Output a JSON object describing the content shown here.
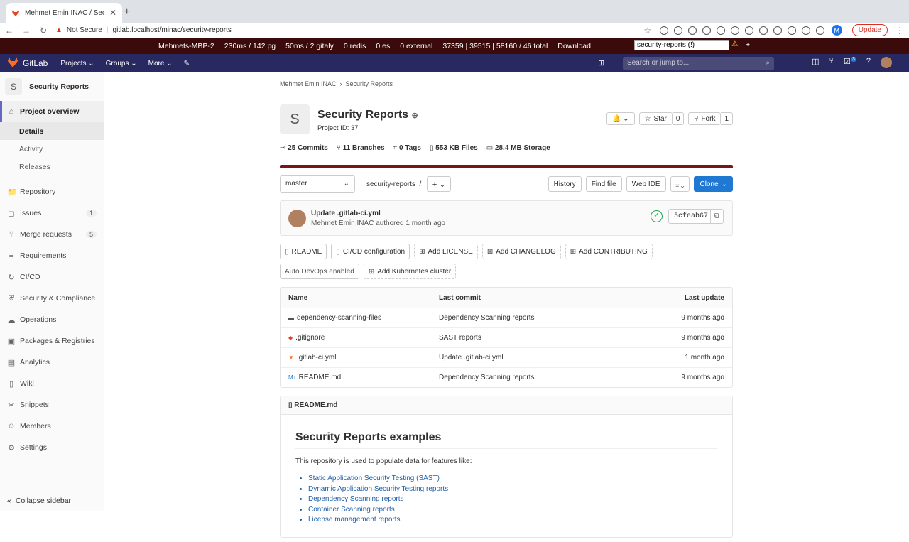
{
  "browser": {
    "tab_title": "Mehmet Emin INAC / Security R",
    "not_secure": "Not Secure",
    "url": "gitlab.localhost/minac/security-reports",
    "update": "Update",
    "profile_initial": "M"
  },
  "perf": {
    "host": "Mehmets-MBP-2",
    "pg": "230ms / 142 pg",
    "gitaly": "50ms / 2 gitaly",
    "redis": "0 redis",
    "es": "0 es",
    "external": "0 external",
    "total": "37359 | 39515 | 58160 / 46 total",
    "download": "Download",
    "select": "security-reports (!)"
  },
  "nav": {
    "brand": "GitLab",
    "projects": "Projects",
    "groups": "Groups",
    "more": "More",
    "search_placeholder": "Search or jump to...",
    "todo_count": "3"
  },
  "sidebar": {
    "avatar": "S",
    "project": "Security Reports",
    "overview": "Project overview",
    "subs": [
      "Details",
      "Activity",
      "Releases"
    ],
    "items": [
      {
        "label": "Repository",
        "icon": "📁"
      },
      {
        "label": "Issues",
        "icon": "◻",
        "badge": "1"
      },
      {
        "label": "Merge requests",
        "icon": "⑂",
        "badge": "5"
      },
      {
        "label": "Requirements",
        "icon": "≡"
      },
      {
        "label": "CI/CD",
        "icon": "↻"
      },
      {
        "label": "Security & Compliance",
        "icon": "⛨"
      },
      {
        "label": "Operations",
        "icon": "☁"
      },
      {
        "label": "Packages & Registries",
        "icon": "▣"
      },
      {
        "label": "Analytics",
        "icon": "▤"
      },
      {
        "label": "Wiki",
        "icon": "▯"
      },
      {
        "label": "Snippets",
        "icon": "✂"
      },
      {
        "label": "Members",
        "icon": "☺"
      },
      {
        "label": "Settings",
        "icon": "⚙"
      }
    ],
    "collapse": "Collapse sidebar"
  },
  "main": {
    "crumb_user": "Mehmet Emin INAC",
    "crumb_proj": "Security Reports",
    "avatar": "S",
    "title": "Security Reports",
    "project_id": "Project ID: 37",
    "star": "Star",
    "star_count": "0",
    "fork": "Fork",
    "fork_count": "1",
    "commits": "25 Commits",
    "branches": "11 Branches",
    "tags": "0 Tags",
    "files": "553 KB Files",
    "storage": "28.4 MB Storage",
    "branch": "master",
    "path": "security-reports",
    "history": "History",
    "find_file": "Find file",
    "web_ide": "Web IDE",
    "clone": "Clone",
    "commit_msg": "Update .gitlab-ci.yml",
    "commit_author": "Mehmet Emin INAC",
    "commit_time": "authored 1 month ago",
    "sha": "5cfeab67",
    "quick": [
      {
        "label": "README",
        "style": "solid"
      },
      {
        "label": "CI/CD configuration",
        "style": "solid"
      },
      {
        "label": "Add LICENSE",
        "style": "dash"
      },
      {
        "label": "Add CHANGELOG",
        "style": "dash"
      },
      {
        "label": "Add CONTRIBUTING",
        "style": "dash"
      },
      {
        "label": "Auto DevOps enabled",
        "style": "plain"
      },
      {
        "label": "Add Kubernetes cluster",
        "style": "dash"
      }
    ],
    "table_headers": [
      "Name",
      "Last commit",
      "Last update"
    ],
    "files_list": [
      {
        "name": "dependency-scanning-files",
        "commit": "Dependency Scanning reports",
        "updated": "9 months ago",
        "icon": "folder-icon"
      },
      {
        "name": ".gitignore",
        "commit": "SAST reports",
        "updated": "9 months ago",
        "icon": "git-icon"
      },
      {
        "name": ".gitlab-ci.yml",
        "commit": "Update .gitlab-ci.yml",
        "updated": "1 month ago",
        "icon": "gitlab-icon"
      },
      {
        "name": "README.md",
        "commit": "Dependency Scanning reports",
        "updated": "9 months ago",
        "icon": "markdown-icon"
      }
    ],
    "readme_file": "README.md",
    "readme_h": "Security Reports examples",
    "readme_p": "This repository is used to populate data for features like:",
    "readme_links": [
      "Static Application Security Testing (SAST)",
      "Dynamic Application Security Testing reports",
      "Dependency Scanning reports",
      "Container Scanning reports",
      "License management reports"
    ]
  }
}
